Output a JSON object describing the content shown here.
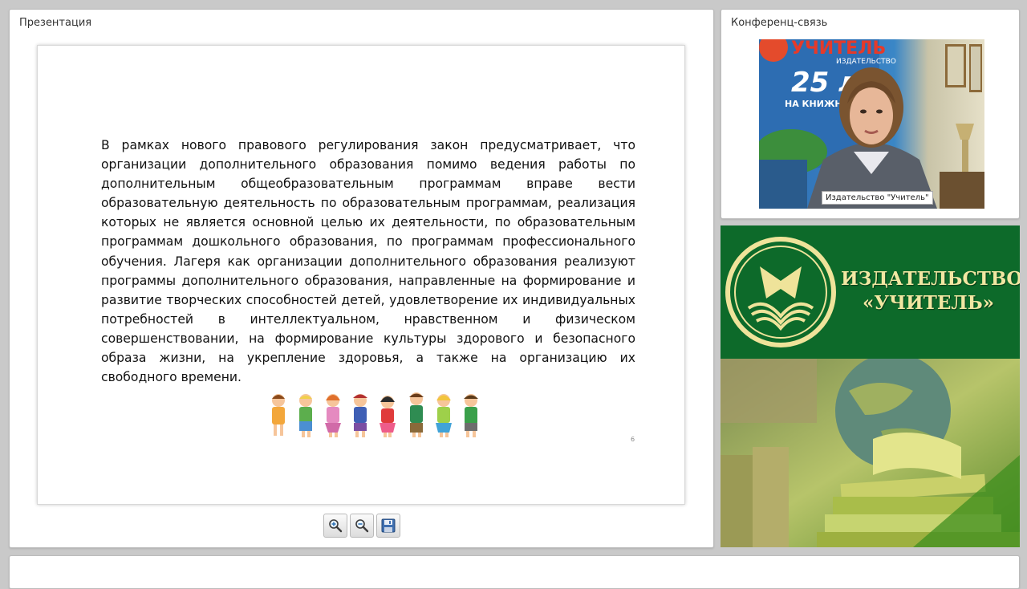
{
  "presentation": {
    "title": "Презентация",
    "slide": {
      "text": "В рамках нового правового регулирования закон предусматривает, что организации дополнительного образования помимо ведения работы по дополнительным общеобразовательным программам вправе вести образовательную деятельность по образовательным программам, реализация которых не является основной целью их деятельности, по образовательным программам дошкольного образования, по программам профессионального обучения. Лагеря как организации дополнительного образования реализуют программы дополнительного образования, направленные на формирование и развитие творческих способностей детей, удовлетворение их индивидуальных потребностей в интеллектуальном, нравственном и физическом совершенствовании, на формирование культуры здорового и безопасного образа жизни, на укрепление здоровья, а также на организацию их свободного времени.",
      "page_number": "6"
    },
    "toolbar": [
      {
        "name": "zoom-in",
        "icon": "magnifier-plus-icon"
      },
      {
        "name": "zoom-out",
        "icon": "magnifier-minus-icon"
      },
      {
        "name": "save",
        "icon": "floppy-disk-icon"
      }
    ]
  },
  "conference": {
    "title": "Конференц-связь",
    "video_caption": "Издательство \"Учитель\"",
    "poster_lines": [
      "УЧИТЕЛЬ",
      "ИЗДАТЕЛЬСТВО",
      "25 л",
      "НА КНИЖН"
    ]
  },
  "banner": {
    "line1": "ИЗДАТЕЛЬСТВО",
    "line2": "«УЧИТЕЛЬ»"
  },
  "colors": {
    "banner_green": "#0d6a2a",
    "banner_text": "#f1e7a2",
    "page_bg": "#c9c9c9"
  }
}
